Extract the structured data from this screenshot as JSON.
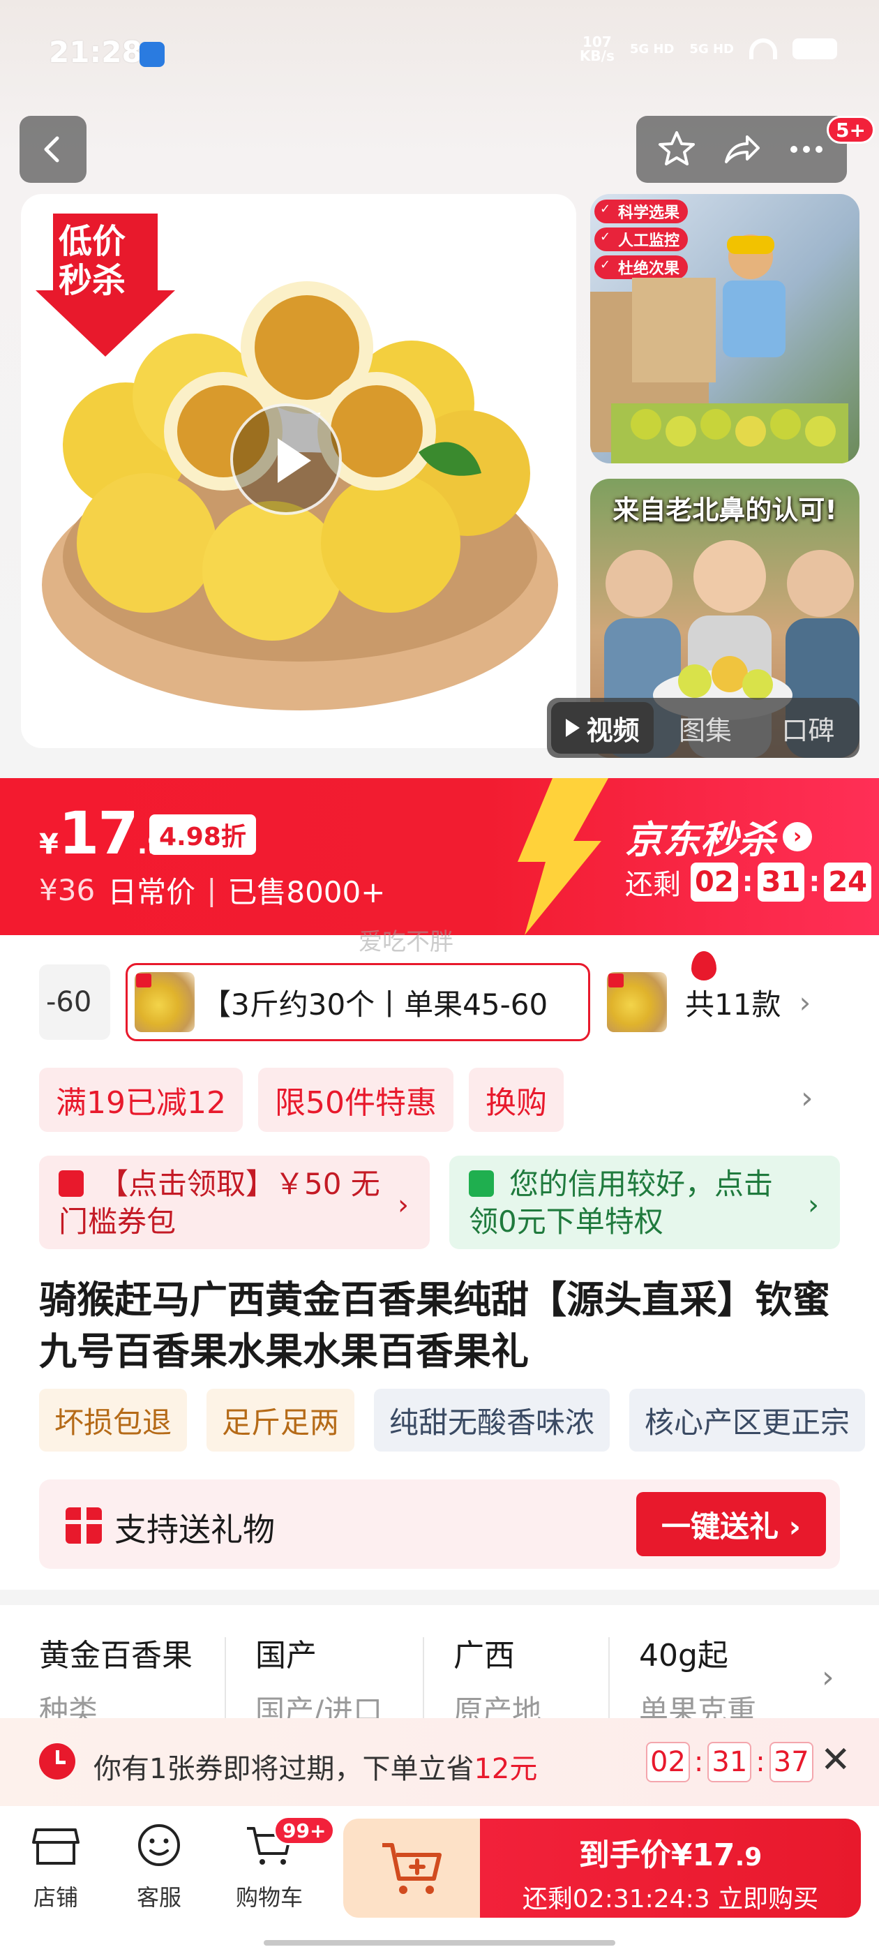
{
  "status_bar": {
    "time": "21:28",
    "net_speed": "107",
    "net_unit": "KB/s",
    "signal1": "5G HD",
    "signal2": "5G HD"
  },
  "nav": {
    "badge": "5+"
  },
  "hero": {
    "promo_line1": "低价",
    "promo_line2": "秒杀"
  },
  "thumbs": {
    "labels": [
      "科学选果",
      "人工监控",
      "杜绝次果"
    ],
    "thumb2_title": "来自老北鼻的认可!"
  },
  "media_tabs": [
    "视频",
    "图集",
    "口碑"
  ],
  "price": {
    "symbol": "¥",
    "integer": "17",
    "decimal": ".9",
    "discount": "4.98折",
    "original": "¥36",
    "original_label": "日常价",
    "separator": "|",
    "sold": "已售8000+",
    "flash_title": "京东秒杀",
    "remaining_label": "还剩",
    "cd_h": "02",
    "cd_m": "31",
    "cd_s": "24",
    "watermark": "爱吃不胖"
  },
  "variants": {
    "prev_text": "-60",
    "selected_text": "【3斤约30个丨单果45-60",
    "count_text": "共11款"
  },
  "promo_tags": [
    "满19已减12",
    "限50件特惠",
    "换购"
  ],
  "coupons": {
    "red_text": "【点击领取】￥50 无门槛券包",
    "green_text": "您的信用较好，点击领0元下单特权"
  },
  "product": {
    "title": "骑猴赶马广西黄金百香果纯甜【源头直采】钦蜜九号百香果水果水果百香果礼"
  },
  "feature_tags": [
    "坏损包退",
    "足斤足两",
    "纯甜无酸香味浓",
    "核心产区更正宗"
  ],
  "gift": {
    "label": "支持送礼物",
    "button": "一键送礼 ›"
  },
  "specs": [
    {
      "value": "黄金百香果",
      "key": "种类"
    },
    {
      "value": "国产",
      "key": "国产/进口"
    },
    {
      "value": "广西",
      "key": "原产地"
    },
    {
      "value": "40g起",
      "key": "单果克重"
    }
  ],
  "expire": {
    "text_before": "你有1张券即将过期，下单立省",
    "amount": "12元",
    "h": "02",
    "m": "31",
    "s": "37"
  },
  "bottom": {
    "shop": "店铺",
    "service": "客服",
    "cart": "购物车",
    "cart_badge": "99+",
    "buy_title": "到手价¥17",
    "buy_title_dec": ".9",
    "buy_sub": "还剩02:31:24:3 立即购买"
  },
  "colors": {
    "brand_red": "#e8192c",
    "banner_red": "#f31a2f",
    "green": "#1faf4f"
  }
}
